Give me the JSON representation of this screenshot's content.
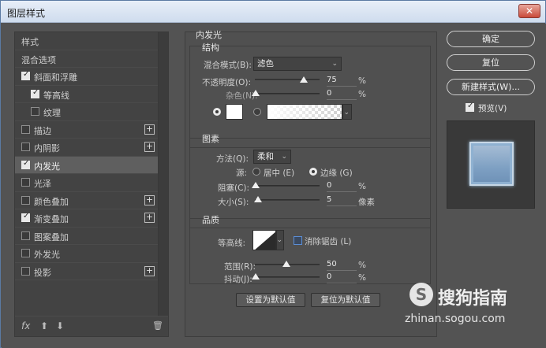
{
  "window": {
    "title": "图层样式",
    "close_label": "✕"
  },
  "left_panel": {
    "items": [
      {
        "label": "样式",
        "checkbox": null,
        "plus": false,
        "indent": 0,
        "selected": false
      },
      {
        "label": "混合选项",
        "checkbox": null,
        "plus": false,
        "indent": 0,
        "selected": false
      },
      {
        "label": "斜面和浮雕",
        "checkbox": true,
        "plus": false,
        "indent": 0,
        "selected": false
      },
      {
        "label": "等高线",
        "checkbox": true,
        "plus": false,
        "indent": 1,
        "selected": false
      },
      {
        "label": "纹理",
        "checkbox": false,
        "plus": false,
        "indent": 1,
        "selected": false
      },
      {
        "label": "描边",
        "checkbox": false,
        "plus": true,
        "indent": 0,
        "selected": false
      },
      {
        "label": "内阴影",
        "checkbox": false,
        "plus": true,
        "indent": 0,
        "selected": false
      },
      {
        "label": "内发光",
        "checkbox": true,
        "plus": false,
        "indent": 0,
        "selected": true
      },
      {
        "label": "光泽",
        "checkbox": false,
        "plus": false,
        "indent": 0,
        "selected": false
      },
      {
        "label": "颜色叠加",
        "checkbox": false,
        "plus": true,
        "indent": 0,
        "selected": false
      },
      {
        "label": "渐变叠加",
        "checkbox": true,
        "plus": true,
        "indent": 0,
        "selected": false
      },
      {
        "label": "图案叠加",
        "checkbox": false,
        "plus": false,
        "indent": 0,
        "selected": false
      },
      {
        "label": "外发光",
        "checkbox": false,
        "plus": false,
        "indent": 0,
        "selected": false
      },
      {
        "label": "投影",
        "checkbox": false,
        "plus": true,
        "indent": 0,
        "selected": false
      }
    ],
    "footer": {
      "fx": "fx",
      "up": "⬆",
      "down": "⬇",
      "trash": "🗑"
    }
  },
  "inner_glow": {
    "title": "内发光",
    "structure": {
      "title": "结构",
      "blend_mode_label": "混合模式(B):",
      "blend_mode_value": "滤色",
      "opacity_label": "不透明度(O):",
      "opacity_value": "75",
      "opacity_unit": "%",
      "noise_label": "杂色(N):",
      "noise_value": "0",
      "noise_unit": "%"
    },
    "elements": {
      "title": "图素",
      "technique_label": "方法(Q):",
      "technique_value": "柔和",
      "source_label": "源:",
      "source_center": "居中 (E)",
      "source_edge": "边缘 (G)",
      "choke_label": "阻塞(C):",
      "choke_value": "0",
      "choke_unit": "%",
      "size_label": "大小(S):",
      "size_value": "5",
      "size_unit": "像素"
    },
    "quality": {
      "title": "品质",
      "contour_label": "等高线:",
      "antialias_label": "消除锯齿 (L)",
      "range_label": "范围(R):",
      "range_value": "50",
      "range_unit": "%",
      "jitter_label": "抖动(J):",
      "jitter_value": "0",
      "jitter_unit": "%"
    },
    "set_default": "设置为默认值",
    "reset_default": "复位为默认值"
  },
  "right_buttons": {
    "ok": "确定",
    "reset": "复位",
    "new_style": "新建样式(W)...",
    "preview_label": "预览(V)"
  },
  "watermark": {
    "brand": "搜狗指南",
    "url": "zhinan.sogou.com"
  },
  "colors": {
    "panel_bg": "#535353",
    "list_bg": "#434343",
    "selected_row": "#5f5f5f",
    "preview_tile": "#7ea0c3"
  }
}
